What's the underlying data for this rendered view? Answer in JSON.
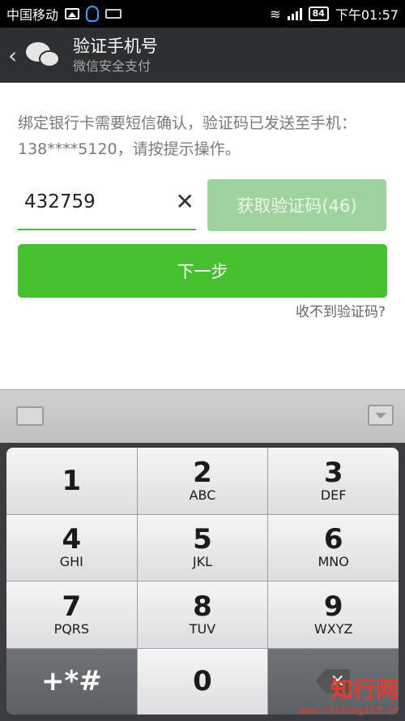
{
  "status_bar": {
    "carrier": "中国移动",
    "battery": "84",
    "time": "下午01:57"
  },
  "header": {
    "back_icon": "‹",
    "title": "验证手机号",
    "subtitle": "微信安全支付"
  },
  "content": {
    "description": "绑定银行卡需要短信确认，验证码已发送至手机：138****5120，请按提示操作。",
    "code_value": "432759",
    "clear_icon": "✕",
    "get_code_label": "获取验证码(46)",
    "next_label": "下一步",
    "no_code_link": "收不到验证码?"
  },
  "keyboard": {
    "keys": [
      {
        "num": "1",
        "letters": ""
      },
      {
        "num": "2",
        "letters": "ABC"
      },
      {
        "num": "3",
        "letters": "DEF"
      },
      {
        "num": "4",
        "letters": "GHI"
      },
      {
        "num": "5",
        "letters": "JKL"
      },
      {
        "num": "6",
        "letters": "MNO"
      },
      {
        "num": "7",
        "letters": "PQRS"
      },
      {
        "num": "8",
        "letters": "TUV"
      },
      {
        "num": "9",
        "letters": "WXYZ"
      }
    ],
    "symbol_key": "+*#",
    "zero_key": "0"
  },
  "watermark": {
    "main": "知行网",
    "url": "www.zhixing123.cn"
  },
  "colors": {
    "primary_green": "#45c02f",
    "disabled_green": "#9fd39d",
    "header_bg": "#2d3033"
  }
}
